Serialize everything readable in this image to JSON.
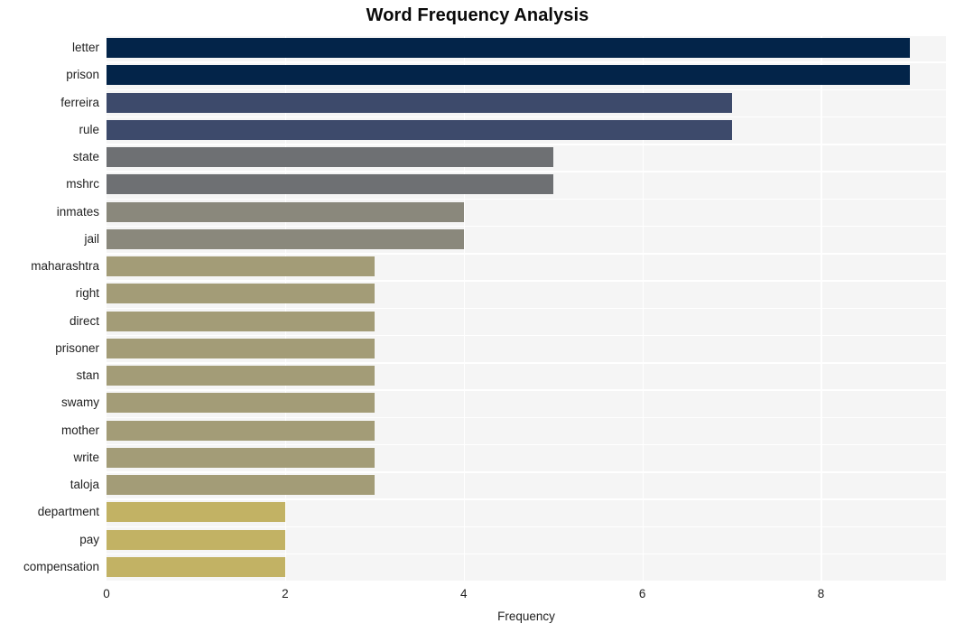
{
  "chart_data": {
    "type": "bar",
    "orientation": "horizontal",
    "title": "Word Frequency Analysis",
    "xlabel": "Frequency",
    "ylabel": "",
    "xlim": [
      0,
      9.4
    ],
    "ylim": null,
    "grid": true,
    "legend": null,
    "xticks": [
      "0",
      "2",
      "4",
      "6",
      "8"
    ],
    "xtick_values": [
      0,
      2,
      4,
      6,
      8
    ],
    "categories": [
      "letter",
      "prison",
      "ferreira",
      "rule",
      "state",
      "mshrc",
      "inmates",
      "jail",
      "maharashtra",
      "right",
      "direct",
      "prisoner",
      "stan",
      "swamy",
      "mother",
      "write",
      "taloja",
      "department",
      "pay",
      "compensation"
    ],
    "values": [
      9,
      9,
      7,
      7,
      5,
      5,
      4,
      4,
      3,
      3,
      3,
      3,
      3,
      3,
      3,
      3,
      3,
      2,
      2,
      2
    ],
    "bar_colors": [
      "#032449",
      "#032449",
      "#3d4a6b",
      "#3d4a6b",
      "#6e7073",
      "#6e7073",
      "#8a887c",
      "#8a887c",
      "#a39c77",
      "#a39c77",
      "#a39c77",
      "#a39c77",
      "#a39c77",
      "#a39c77",
      "#a39c77",
      "#a39c77",
      "#a39c77",
      "#c2b264",
      "#c2b264",
      "#c2b264"
    ],
    "plot_background": "#f5f5f5",
    "gridline_color": "#ffffff",
    "text_color": "#222222",
    "title_color": "#0a0a0a"
  }
}
